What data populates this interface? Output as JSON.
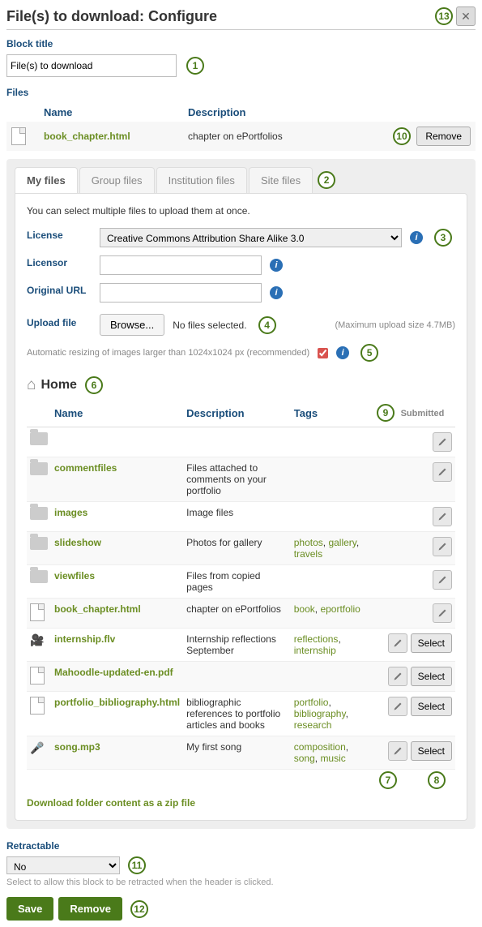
{
  "header": {
    "title": "File(s) to download: Configure"
  },
  "annotations": {
    "a1": "1",
    "a2": "2",
    "a3": "3",
    "a4": "4",
    "a5": "5",
    "a6": "6",
    "a7": "7",
    "a8": "8",
    "a9": "9",
    "a10": "10",
    "a11": "11",
    "a12": "12",
    "a13": "13"
  },
  "block_title": {
    "label": "Block title",
    "value": "File(s) to download"
  },
  "files_label": "Files",
  "selected_table": {
    "headers": {
      "name": "Name",
      "description": "Description"
    },
    "row": {
      "name": "book_chapter.html",
      "desc": "chapter on ePortfolios"
    },
    "remove": "Remove"
  },
  "tabs": {
    "my": "My files",
    "group": "Group files",
    "inst": "Institution files",
    "site": "Site files"
  },
  "upload_intro": "You can select multiple files to upload them at once.",
  "license": {
    "label": "License",
    "value": "Creative Commons Attribution Share Alike 3.0"
  },
  "licensor": {
    "label": "Licensor"
  },
  "original_url": {
    "label": "Original URL"
  },
  "upload_file": {
    "label": "Upload file",
    "browse": "Browse...",
    "status": "No files selected.",
    "max": "(Maximum upload size 4.7MB)"
  },
  "resize_note": "Automatic resizing of images larger than 1024x1024 px (recommended)",
  "home": "Home",
  "file_headers": {
    "name": "Name",
    "description": "Description",
    "tags": "Tags"
  },
  "submitted": "Submitted",
  "rows": [
    {
      "type": "folder",
      "name": "",
      "desc": "",
      "tags": [],
      "select": false
    },
    {
      "type": "folder",
      "name": "commentfiles",
      "desc": "Files attached to comments on your portfolio",
      "tags": [],
      "select": false
    },
    {
      "type": "folder",
      "name": "images",
      "desc": "Image files",
      "tags": [],
      "select": false
    },
    {
      "type": "folder",
      "name": "slideshow",
      "desc": "Photos for gallery",
      "tags": [
        "photos",
        "gallery",
        "travels"
      ],
      "select": false
    },
    {
      "type": "folder",
      "name": "viewfiles",
      "desc": "Files from copied pages",
      "tags": [],
      "select": false
    },
    {
      "type": "file",
      "name": "book_chapter.html",
      "desc": "chapter on ePortfolios",
      "tags": [
        "book",
        "eportfolio"
      ],
      "select": false
    },
    {
      "type": "video",
      "name": "internship.flv",
      "desc": "Internship reflections September",
      "tags": [
        "reflections",
        "internship"
      ],
      "select": true
    },
    {
      "type": "file",
      "name": "Mahoodle-updated-en.pdf",
      "desc": "",
      "tags": [],
      "select": true
    },
    {
      "type": "file",
      "name": "portfolio_bibliography.html",
      "desc": "bibliographic references to portfolio articles and books",
      "tags": [
        "portfolio",
        "bibliography",
        "research"
      ],
      "select": true
    },
    {
      "type": "audio",
      "name": "song.mp3",
      "desc": "My first song",
      "tags": [
        "composition",
        "song",
        "music"
      ],
      "select": true
    }
  ],
  "select_label": "Select",
  "download_zip": "Download folder content as a zip file",
  "retractable": {
    "label": "Retractable",
    "value": "No",
    "help": "Select to allow this block to be retracted when the header is clicked."
  },
  "save": "Save",
  "remove": "Remove"
}
